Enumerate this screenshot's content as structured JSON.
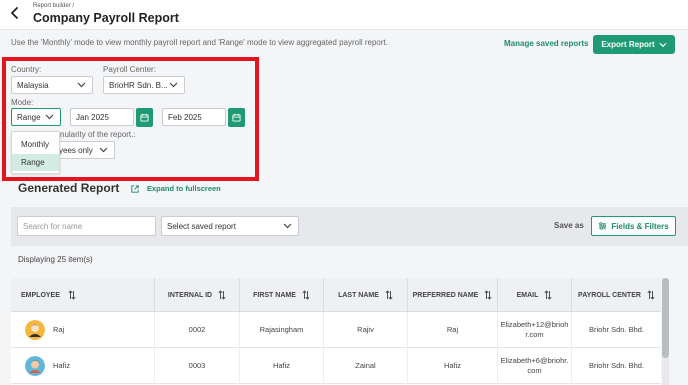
{
  "header": {
    "breadcrumb": "Report builder /",
    "title": "Company Payroll Report"
  },
  "hint": "Use the 'Monthly' mode to view monthly payroll report and 'Range' mode to view aggregated payroll report.",
  "actions": {
    "manage_saved": "Manage saved reports",
    "export": "Export Report"
  },
  "filters": {
    "country_label": "Country:",
    "country_value": "Malaysia",
    "payroll_center_label": "Payroll Center:",
    "payroll_center_value": "BrioHR Sdn. B...",
    "mode_label": "Mode:",
    "mode_value": "Range",
    "start_date": "Jan 2025",
    "end_date": "Feb 2025",
    "granularity_label": "nularity of the report.:",
    "granularity_value": "yees only",
    "mode_options": [
      "Monthly",
      "Range"
    ]
  },
  "report": {
    "title": "Generated Report",
    "fullscreen": "Expand to fullscreen",
    "search_placeholder": "Search for name",
    "saved_report_placeholder": "Select saved report",
    "save_as": "Save as",
    "fields_filters": "Fields & Filters",
    "displaying": "Displaying 25 item(s)"
  },
  "table": {
    "columns": [
      "EMPLOYEE",
      "INTERNAL ID",
      "FIRST NAME",
      "LAST NAME",
      "PREFERRED NAME",
      "EMAIL",
      "PAYROLL CENTER"
    ],
    "rows": [
      {
        "employee": "Raj",
        "internal_id": "0002",
        "first_name": "Rajasingham",
        "last_name": "Rajiv",
        "preferred_name": "Raj",
        "email_line1": "Elizabeth+12@brioh",
        "email_line2": "r.com",
        "payroll_center": "Briohr Sdn. Bhd."
      },
      {
        "employee": "Hafiz",
        "internal_id": "0003",
        "first_name": "Hafiz",
        "last_name": "Zainal",
        "preferred_name": "Hafiz",
        "email_line1": "Elizabeth+6@briohr.",
        "email_line2": "com",
        "payroll_center": "Briohr Sdn. Bhd."
      }
    ]
  },
  "colors": {
    "accent": "#1f9b74",
    "highlight": "#e3141e"
  }
}
